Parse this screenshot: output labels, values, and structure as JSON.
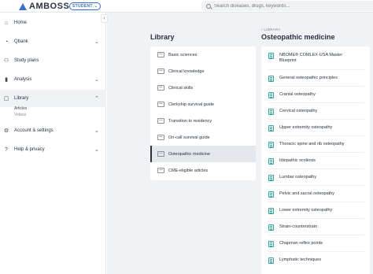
{
  "header": {
    "brand": "AMBOSS",
    "badge": "STUDENT",
    "search": {
      "placeholder": "Search diseases, drugs, keywords..."
    }
  },
  "sidebar": {
    "collapse": "‹",
    "items": [
      {
        "label": "Home",
        "icon": "home-icon"
      },
      {
        "label": "Qbank",
        "icon": "qbank-icon"
      },
      {
        "label": "Study plans",
        "icon": "study-plans-icon"
      },
      {
        "label": "Analysis",
        "icon": "analysis-icon"
      },
      {
        "label": "Library",
        "icon": "library-icon"
      },
      {
        "label": "Account & settings",
        "icon": "gear-icon"
      },
      {
        "label": "Help & privacy",
        "icon": "help-icon"
      }
    ],
    "library_sub": [
      "Articles",
      "Videos"
    ]
  },
  "library": {
    "title": "Library",
    "items": [
      "Basic sciences",
      "Clinical knowledge",
      "Clinical skills",
      "Clerkship survival guide",
      "Transition to residency",
      "On-call survival guide",
      "Osteopathic medicine",
      "CME-eligible articles"
    ],
    "active_index": 6
  },
  "section": {
    "breadcrumb": "‹ LIBRARY",
    "title": "Osteopathic medicine",
    "articles": [
      "NBOME® COMLEX-USA Master Blueprint",
      "General osteopathic principles",
      "Cranial osteopathy",
      "Cervical osteopathy",
      "Upper extremity osteopathy",
      "Thoracic spine and rib osteopathy",
      "Idiopathic scoliosis",
      "Lumbar osteopathy",
      "Pelvic and sacral osteopathy",
      "Lower extremity osteopathy",
      "Strain-counterstrain",
      "Chapman reflex points",
      "Lymphatic techniques"
    ]
  },
  "colors": {
    "accent": "#3a6fd1",
    "article_icon": "#3aa6a0",
    "main_bg": "#f0f2f5"
  }
}
